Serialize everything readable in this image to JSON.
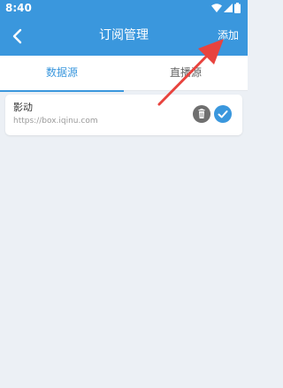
{
  "status_bar": {
    "time": "8:40",
    "icons": [
      "wifi-icon",
      "signal-icon",
      "battery-icon"
    ]
  },
  "nav": {
    "title": "订阅管理",
    "back_icon": "back-arrow-icon",
    "add_label": "添加"
  },
  "tabs": [
    {
      "label": "数据源",
      "active": true
    },
    {
      "label": "直播源",
      "active": false
    }
  ],
  "sources": [
    {
      "name": "影动",
      "url": "https://box.iqinu.com",
      "actions": [
        "delete-icon",
        "check-icon"
      ]
    }
  ],
  "colors": {
    "primary": "#3a97dd",
    "background": "#ecf0f5",
    "annotation_arrow": "#e8433e",
    "delete_button": "#6f6f6f"
  }
}
